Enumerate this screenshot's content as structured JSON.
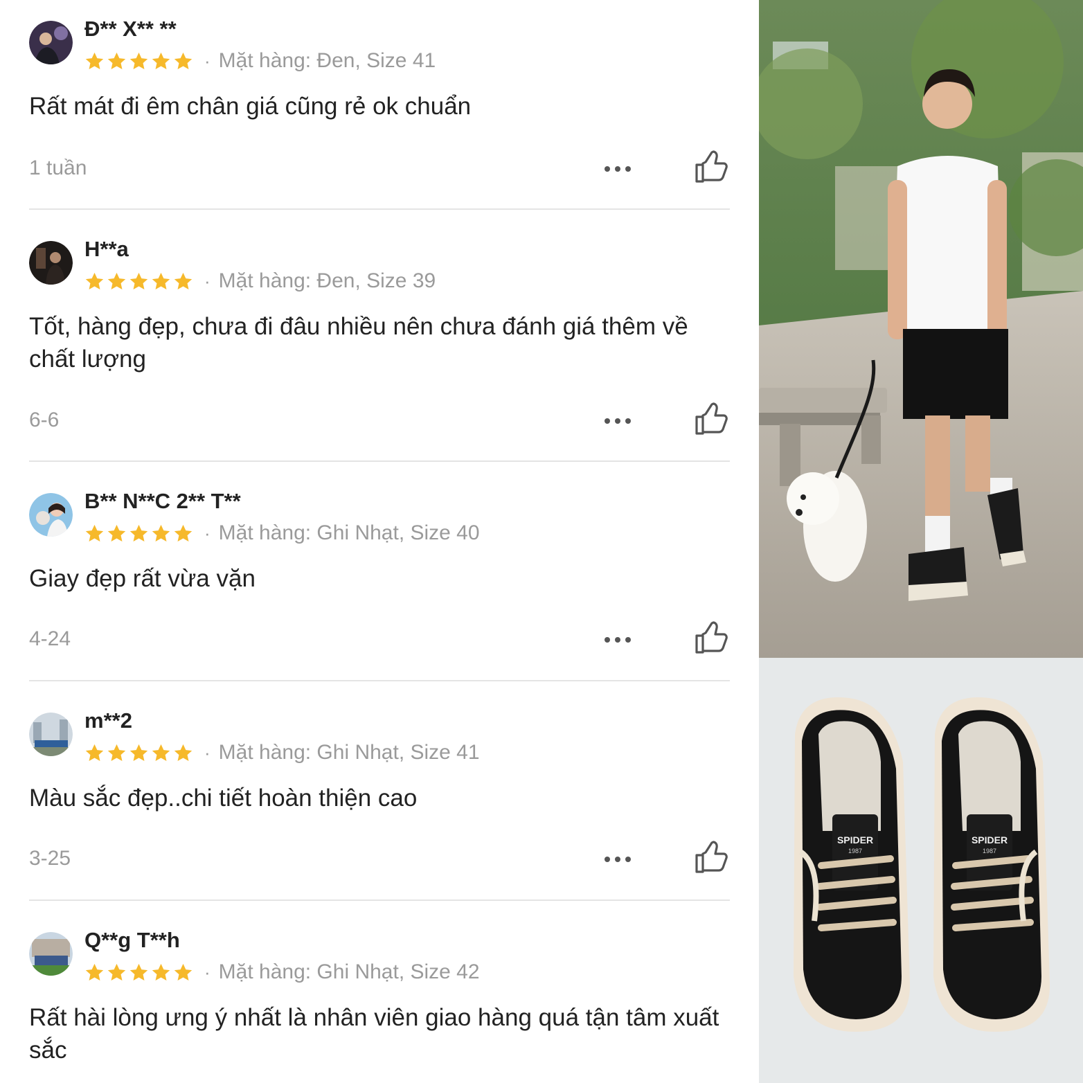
{
  "reviews": [
    {
      "user": "Đ** X** **",
      "rating": 5,
      "variant": "Mặt hàng: Đen, Size 41",
      "text": "Rất mát đi êm chân giá cũng rẻ ok chuẩn",
      "date": "1 tuần"
    },
    {
      "user": "H**a",
      "rating": 5,
      "variant": "Mặt hàng: Đen, Size 39",
      "text": "Tốt, hàng đẹp, chưa đi đâu nhiều nên chưa đánh giá thêm về chất lượng",
      "date": "6-6"
    },
    {
      "user": "B** N**C 2** T**",
      "rating": 5,
      "variant": "Mặt hàng: Ghi Nhạt, Size 40",
      "text": "Giay đẹp rất vừa vặn",
      "date": "4-24"
    },
    {
      "user": "m**2",
      "rating": 5,
      "variant": "Mặt hàng: Ghi Nhạt, Size 41",
      "text": "Màu sắc đẹp..chi tiết hoàn thiện cao",
      "date": "3-25"
    },
    {
      "user": "Q**g T**h",
      "rating": 5,
      "variant": "Mặt hàng: Ghi Nhạt, Size 42",
      "text": "Rất hài lòng ưng ý nhất là nhân viên giao hàng quá tận tâm xuất sắc",
      "date": ""
    }
  ],
  "separator": "·",
  "product_photo": {
    "tongue_label": "SPIDER",
    "tongue_year": "1987"
  },
  "colors": {
    "star": "#f6b92b",
    "muted_text": "#9a9a9a",
    "divider": "#e4e4e4",
    "icon": "#555555"
  },
  "icons": {
    "rating": "star-icon",
    "more": "more-options-icon",
    "like": "thumbs-up-icon"
  }
}
